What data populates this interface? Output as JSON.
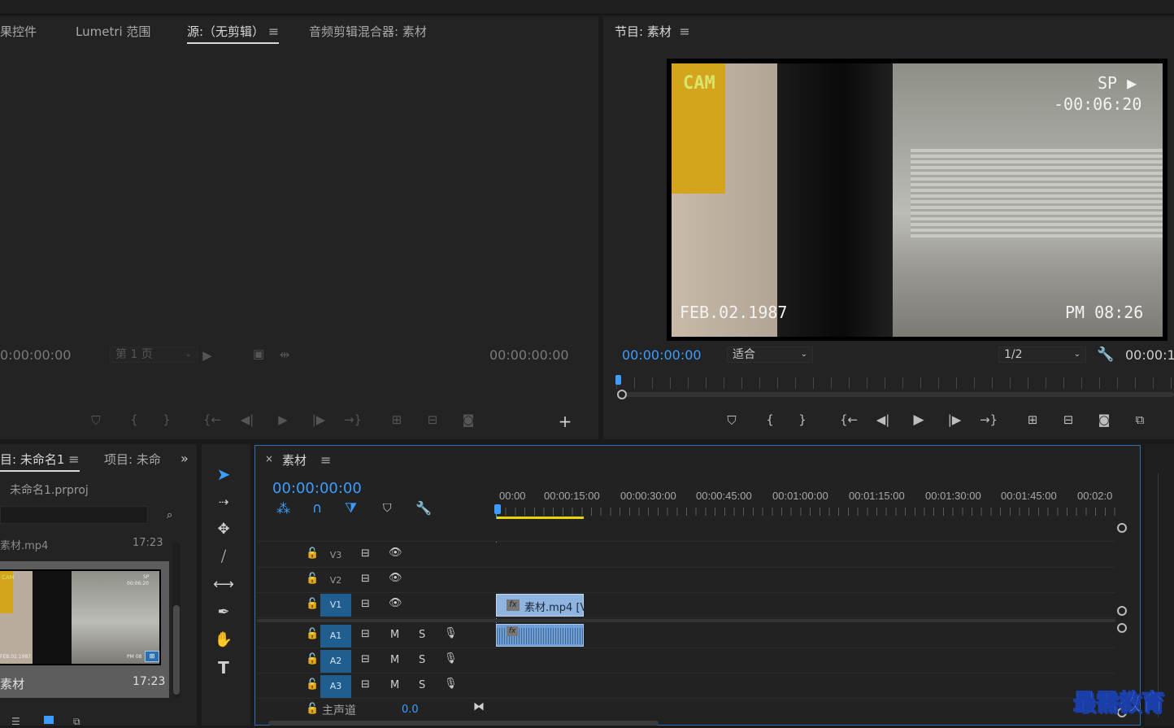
{
  "source_panel": {
    "tabs": [
      "果控件",
      "Lumetri 范围",
      "源:（无剪辑）",
      "音频剪辑混合器: 素材"
    ],
    "timecode_left": "0:00:00:00",
    "page_dropdown": "第 1 页",
    "timecode_right": "00:00:00:00"
  },
  "program_panel": {
    "title": "节目: 素材",
    "timecode": "00:00:00:00",
    "fit_dropdown": "适合",
    "resolution_dropdown": "1/2",
    "timecode_right": "00:00:1",
    "overlay": {
      "cam": "CAM",
      "sp": "SP",
      "counter": "-00:06:20",
      "date": "FEB.02.1987",
      "time": "PM 08:26"
    }
  },
  "project_panel": {
    "tabs": [
      "目: 未命名1",
      "项目: 未命"
    ],
    "project_file": "未命名1.prproj",
    "clip_top_name": "素材.mp4",
    "clip_top_duration": "17:23",
    "clip_name": "素材",
    "clip_duration": "17:23",
    "thumb_overlay": {
      "cam": "CAM",
      "sp": "SP",
      "counter": "00:06:20",
      "date": "FEB.02.1987",
      "time": "PM 08"
    }
  },
  "timeline": {
    "title": "素材",
    "timecode": "00:00:00:00",
    "ruler": [
      "00:00",
      "00:00:15:00",
      "00:00:30:00",
      "00:00:45:00",
      "00:01:00:00",
      "00:01:15:00",
      "00:01:30:00",
      "00:01:45:00",
      "00:02:0"
    ],
    "video_tracks": [
      "V3",
      "V2",
      "V1"
    ],
    "audio_tracks": [
      "A1",
      "A2",
      "A3"
    ],
    "mute_label": "M",
    "solo_label": "S",
    "master_label": "主声道",
    "master_value": "0.0",
    "video_clip_label": "素材.mp4 [V",
    "fx_label": "fx"
  },
  "watermark": "最需教育",
  "colors": {
    "accent": "#3d9dff",
    "clip_video": "#8fb4e0",
    "clip_audio": "#6d9fd6",
    "work_area": "#e6d700"
  }
}
